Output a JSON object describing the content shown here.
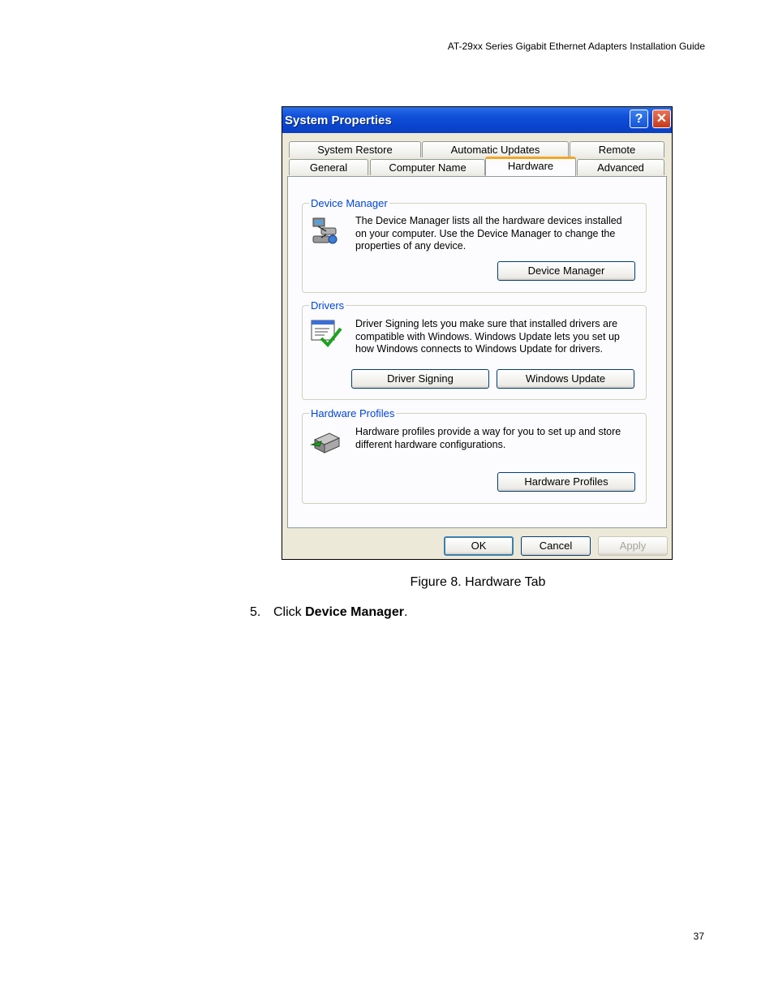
{
  "running_header": "AT-29xx Series Gigabit Ethernet Adapters Installation Guide",
  "page_number": "37",
  "caption": "Figure 8. Hardware Tab",
  "step": {
    "number": "5.",
    "prefix": "Click ",
    "bold": "Device Manager",
    "suffix": "."
  },
  "dialog": {
    "title": "System Properties",
    "help_label": "?",
    "close_label": "✕",
    "tabs_row1": [
      "System Restore",
      "Automatic Updates",
      "Remote"
    ],
    "tabs_row2": [
      "General",
      "Computer Name",
      "Hardware",
      "Advanced"
    ],
    "active_tab": "Hardware",
    "groups": {
      "device_manager": {
        "title": "Device Manager",
        "text": "The Device Manager lists all the hardware devices installed on your computer. Use the Device Manager to change the properties of any device.",
        "button": "Device Manager",
        "icon": "device-manager-icon"
      },
      "drivers": {
        "title": "Drivers",
        "text": "Driver Signing lets you make sure that installed drivers are compatible with Windows. Windows Update lets you set up how Windows connects to Windows Update for drivers.",
        "button1": "Driver Signing",
        "button2": "Windows Update",
        "icon": "driver-signing-icon"
      },
      "hardware_profiles": {
        "title": "Hardware Profiles",
        "text": "Hardware profiles provide a way for you to set up and store different hardware configurations.",
        "button": "Hardware Profiles",
        "icon": "hardware-profiles-icon"
      }
    },
    "footer": {
      "ok": "OK",
      "cancel": "Cancel",
      "apply": "Apply"
    }
  }
}
